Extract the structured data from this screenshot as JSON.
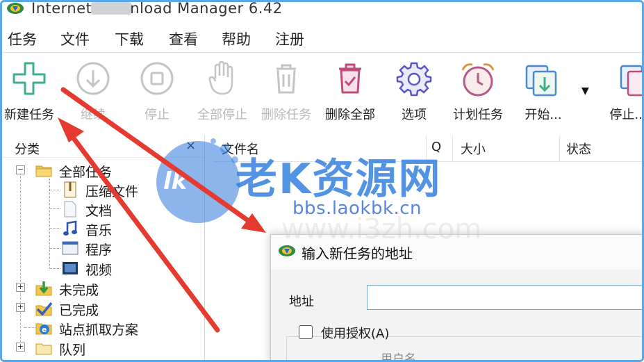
{
  "window": {
    "title": "Internet Download Manager 6.42"
  },
  "menu": [
    "任务",
    "文件",
    "下载",
    "查看",
    "帮助",
    "注册"
  ],
  "toolbar": [
    {
      "label": "新建任务",
      "icon": "add-icon",
      "enabled": true
    },
    {
      "label": "继续",
      "icon": "download-arrow-icon",
      "enabled": false
    },
    {
      "label": "停止",
      "icon": "stop-icon",
      "enabled": false
    },
    {
      "label": "全部停止",
      "icon": "hand-icon",
      "enabled": false
    },
    {
      "label": "删除任务",
      "icon": "trash-icon",
      "enabled": false
    },
    {
      "label": "删除全部",
      "icon": "delete-all-icon",
      "enabled": true
    },
    {
      "label": "选项",
      "icon": "gear-icon",
      "enabled": true
    },
    {
      "label": "计划任务",
      "icon": "alarm-clock-icon",
      "enabled": true
    },
    {
      "label": "开始...",
      "icon": "queue-start-icon",
      "enabled": true
    },
    {
      "label": "停止...",
      "icon": "queue-stop-icon",
      "enabled": true
    }
  ],
  "categories": {
    "header": "分类",
    "close": "×",
    "items": [
      {
        "label": "全部任务",
        "icon": "folder-icon",
        "level": 0,
        "expander": "−"
      },
      {
        "label": "压缩文件",
        "icon": "archive-icon",
        "level": 1
      },
      {
        "label": "文档",
        "icon": "document-icon",
        "level": 1
      },
      {
        "label": "音乐",
        "icon": "music-icon",
        "level": 1
      },
      {
        "label": "程序",
        "icon": "program-icon",
        "level": 1
      },
      {
        "label": "视频",
        "icon": "video-icon",
        "level": 1
      },
      {
        "label": "未完成",
        "icon": "unfinished-icon",
        "level": 0,
        "expander": "+"
      },
      {
        "label": "已完成",
        "icon": "finished-icon",
        "level": 0,
        "expander": "+"
      },
      {
        "label": "站点抓取方案",
        "icon": "site-grabber-icon",
        "level": 0
      },
      {
        "label": "队列",
        "icon": "queue-folder-icon",
        "level": 0,
        "expander": "+"
      }
    ]
  },
  "list_columns": [
    "文件名",
    "Q",
    "大小",
    "状态"
  ],
  "dialog": {
    "title": "输入新任务的地址",
    "address_label": "地址",
    "address_value": "",
    "auth_label": "使用授权(A)",
    "user_label": "用户名"
  },
  "watermark": {
    "badge": "lk",
    "title": "老K资源网",
    "url": "bbs.laokbk.cn",
    "faint": "www.i3zh.com"
  },
  "colors": {
    "frame_border": "#5aa9e6",
    "arrow": "#e53a2f",
    "add_icon": "#3fae8a",
    "delete_all_icon": "#c04a7a",
    "gear_icon": "#5a55c9",
    "clock_icon": "#b5588a",
    "watermark": "#2878dc"
  }
}
